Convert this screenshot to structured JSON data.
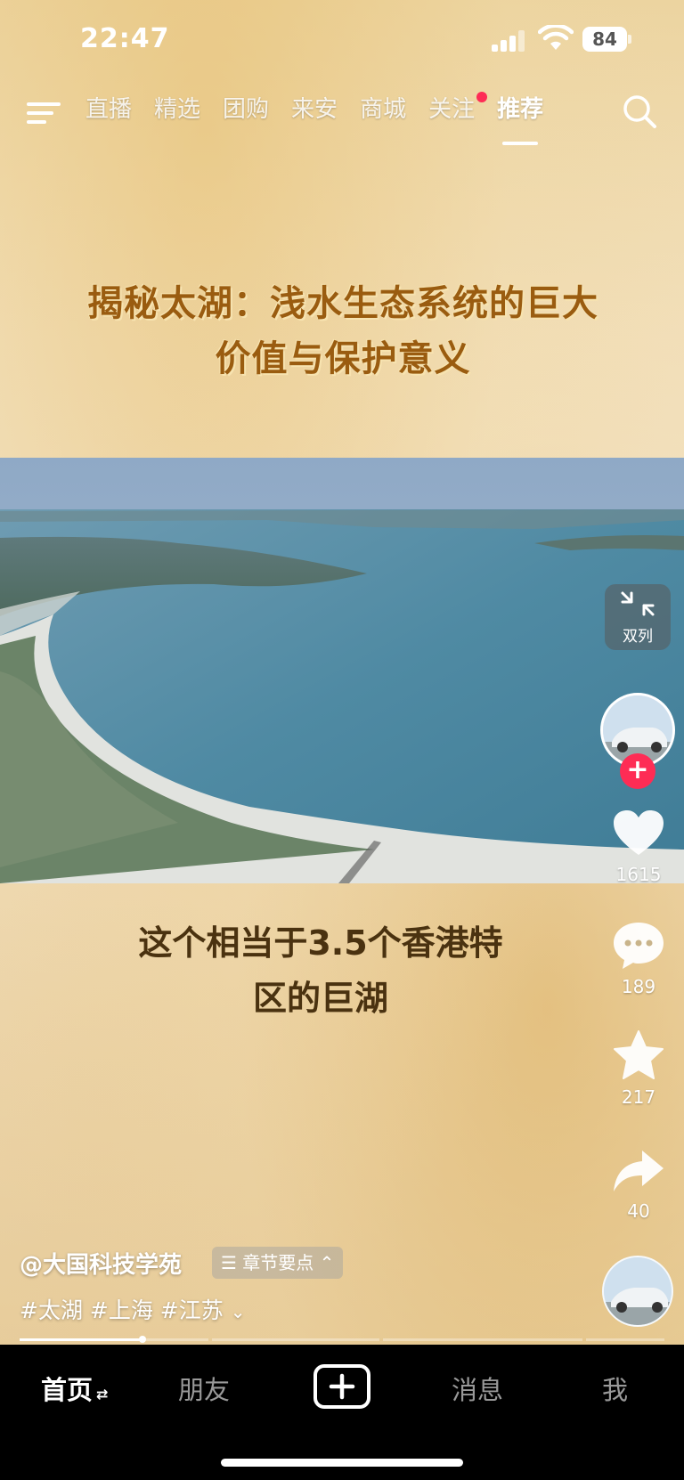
{
  "status_bar": {
    "time": "22:47",
    "battery": "84"
  },
  "top_nav": {
    "tabs": [
      {
        "label": "直播",
        "active": false
      },
      {
        "label": "精选",
        "active": false
      },
      {
        "label": "团购",
        "active": false
      },
      {
        "label": "来安",
        "active": false
      },
      {
        "label": "商城",
        "active": false
      },
      {
        "label": "关注",
        "active": false,
        "has_dot": true
      },
      {
        "label": "推荐",
        "active": true
      }
    ]
  },
  "video": {
    "headline_line1": "揭秘太湖：浅水生态系统的巨大",
    "headline_line2": "价值与保护意义",
    "subtitle_line1": "这个相当于3.5个香港特",
    "subtitle_line2": "区的巨湖"
  },
  "sidebar": {
    "dual_label": "双列",
    "follow_symbol": "+",
    "likes": "1615",
    "comments": "189",
    "favorites": "217",
    "shares": "40"
  },
  "info": {
    "author": "@大国科技学苑",
    "chapter_label": "章节要点",
    "tags": "#太湖 #上海 #江苏"
  },
  "progress": {
    "played_fraction": 0.19
  },
  "bottom_nav": {
    "home": "首页",
    "friends": "朋友",
    "messages": "消息",
    "me": "我"
  },
  "colors": {
    "accent_red": "#fe2c55",
    "headline_color": "#9a5c10",
    "subtitle_color": "#4a3210"
  }
}
